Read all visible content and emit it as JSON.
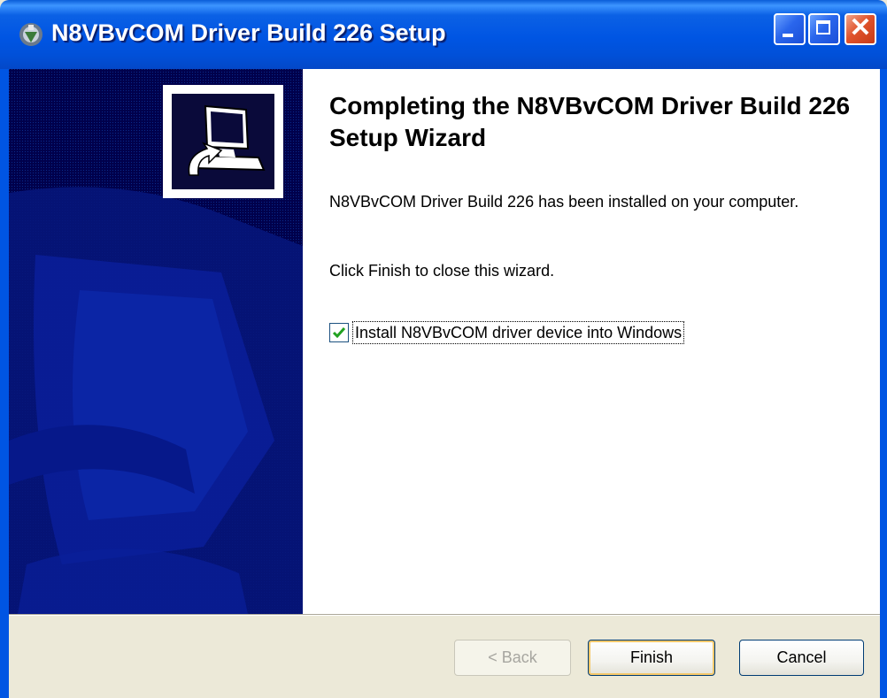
{
  "window": {
    "title": "N8VBvCOM Driver Build 226 Setup",
    "icon": "setup-icon"
  },
  "banner": {
    "icon": "computer-install-icon"
  },
  "content": {
    "heading": "Completing the N8VBvCOM Driver Build 226 Setup Wizard",
    "message": "N8VBvCOM Driver Build 226 has been installed on your computer.",
    "instruction": "Click Finish to close this wizard.",
    "checkbox": {
      "label": "Install N8VBvCOM driver device into Windows",
      "checked": true
    }
  },
  "buttons": {
    "back": "< Back",
    "finish": "Finish",
    "cancel": "Cancel"
  },
  "colors": {
    "titlebar": "#0055e3",
    "banner": "#00004c",
    "dialog_bg": "#ece9d8"
  }
}
